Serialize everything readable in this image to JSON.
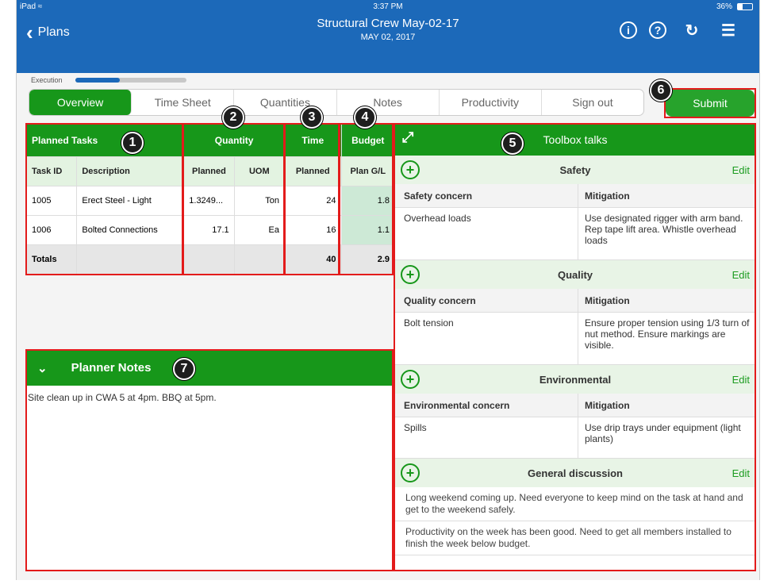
{
  "status": {
    "device": "iPad ≈",
    "time": "3:37 PM",
    "battery": "36%"
  },
  "header": {
    "back_label": "Plans",
    "title": "Structural Crew May-02-17",
    "subtitle": "MAY 02, 2017"
  },
  "progress": {
    "label": "Execution",
    "value": 0.4
  },
  "tabs": [
    "Overview",
    "Time Sheet",
    "Quantities",
    "Notes",
    "Productivity",
    "Sign out"
  ],
  "submit_label": "Submit",
  "badges": [
    "1",
    "2",
    "3",
    "4",
    "5",
    "6",
    "7"
  ],
  "tasks": {
    "groups": {
      "planned_tasks": "Planned Tasks",
      "quantity": "Quantity",
      "time": "Time",
      "budget": "Budget"
    },
    "cols": [
      "Task ID",
      "Description",
      "Planned",
      "UOM",
      "Planned",
      "Plan G/L"
    ],
    "rows": [
      [
        "1005",
        "Erect Steel - Light",
        "1.3249...",
        "Ton",
        "24",
        "1.8"
      ],
      [
        "1006",
        "Bolted Connections",
        "17.1",
        "Ea",
        "16",
        "1.1"
      ]
    ],
    "totals": [
      "Totals",
      "",
      "",
      "",
      "40",
      "2.9"
    ]
  },
  "notes": {
    "title": "Planner Notes",
    "text": "Site clean up in CWA 5 at 4pm. BBQ at 5pm."
  },
  "toolbox": {
    "title": "Toolbox talks",
    "edit_label": "Edit",
    "safety": {
      "name": "Safety",
      "col1": "Safety concern",
      "col2": "Mitigation",
      "c1": "Overhead loads",
      "c2": "Use designated rigger with arm band. Rep tape lift area. Whistle overhead loads"
    },
    "quality": {
      "name": "Quality",
      "col1": "Quality concern",
      "col2": "Mitigation",
      "c1": "Bolt tension",
      "c2": "Ensure proper tension using 1/3 turn of nut method. Ensure markings are visible."
    },
    "environmental": {
      "name": "Environmental",
      "col1": "Environmental concern",
      "col2": "Mitigation",
      "c1": "Spills",
      "c2": "Use drip trays under equipment (light plants)"
    },
    "general": {
      "name": "General discussion",
      "p1": "Long weekend coming up. Need everyone to keep mind on the task at hand and get to the weekend safely.",
      "p2": "Productivity on the week has been good. Need to get all members installed to finish the week below budget."
    }
  }
}
